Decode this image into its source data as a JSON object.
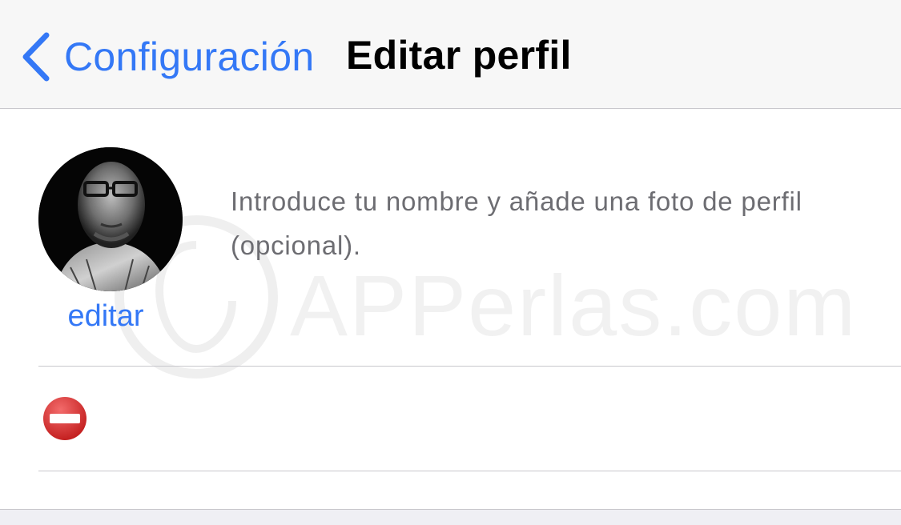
{
  "navbar": {
    "back_label": "Configuración",
    "title": "Editar perfil"
  },
  "profile": {
    "edit_label": "editar",
    "instructions": "Introduce tu nombre y añade una foto de perfil (opcional)."
  },
  "name_field": {
    "value": "",
    "placeholder": ""
  },
  "watermark": {
    "text": "APPerlas.com"
  },
  "icons": {
    "back": "chevron-left-icon",
    "remove": "no-entry-icon"
  },
  "colors": {
    "accent": "#3478f6",
    "remove_red": "#e03a3a",
    "secondary_text": "#6d6d72",
    "separator": "#c8c7cc",
    "navbar_bg": "#f7f7f7"
  }
}
